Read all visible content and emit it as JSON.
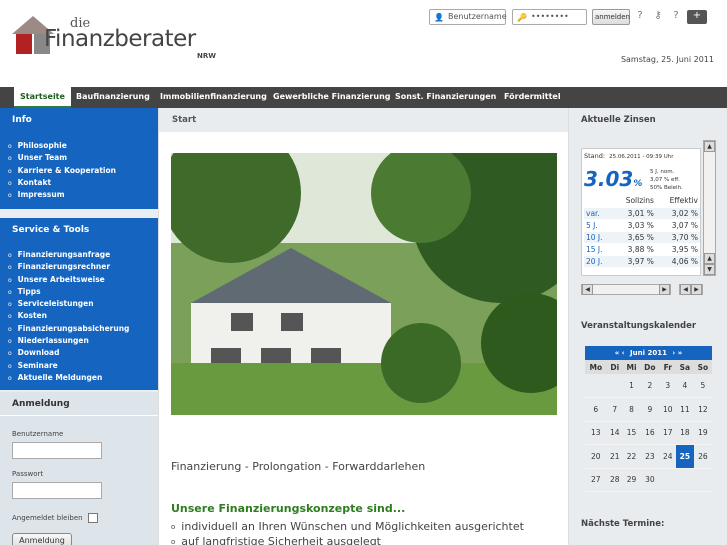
{
  "header": {
    "logo_small": "die",
    "logo_main": "Finanzberater",
    "logo_region": "NRW",
    "username_placeholder": "Benutzername",
    "password_value": "••••••••",
    "login_button": "anmelden",
    "date": "Samstag, 25. Juni 2011"
  },
  "nav": {
    "items": [
      "Startseite",
      "Baufinanzierung",
      "Immobilienfinanzierung",
      "Gewerbliche Finanzierung",
      "Sonst. Finanzierungen",
      "Fördermittel"
    ]
  },
  "sidebar": {
    "info_title": "Info",
    "info_items": [
      "Philosophie",
      "Unser Team",
      "Karriere & Kooperation",
      "Kontakt",
      "Impressum"
    ],
    "service_title": "Service & Tools",
    "service_items": [
      "Finanzierungsanfrage",
      "Finanzierungsrechner",
      "Unsere Arbeitsweise",
      "Tipps",
      "Serviceleistungen",
      "Kosten",
      "Finanzierungsabsicherung",
      "Niederlassungen",
      "Download",
      "Seminare",
      "Aktuelle Meldungen"
    ],
    "login_title": "Anmeldung",
    "username_label": "Benutzername",
    "password_label": "Passwort",
    "remember_label": "Angemeldet bleiben",
    "submit_label": "Anmeldung"
  },
  "main": {
    "breadcrumb": "Start",
    "headline": "Finanzierung - Prolongation - Forwarddarlehen",
    "subheadline": "Unsere Finanzierungskonzepte sind...",
    "bullets": [
      "individuell an Ihren Wünschen und Möglichkeiten ausgerichtet",
      "auf langfristige Sicherheit ausgelegt"
    ]
  },
  "right": {
    "rates_title": "Aktuelle Zinsen",
    "stand_label": "Stand:",
    "stand_value": "25.06.2011 - 09:39 Uhr",
    "big_rate": "3.03",
    "big_rate_unit": "%",
    "small_lines": [
      "5 J. nom.",
      "3,07 % eff.",
      "50% Beleih."
    ],
    "col_sollzins": "Sollzins",
    "col_effektiv": "Effektiv",
    "rates": [
      {
        "term": "var.",
        "soll": "3,01 %",
        "eff": "3,02 %"
      },
      {
        "term": "5 J.",
        "soll": "3,03 %",
        "eff": "3,07 %"
      },
      {
        "term": "10 J.",
        "soll": "3,65 %",
        "eff": "3,70 %"
      },
      {
        "term": "15 J.",
        "soll": "3,88 %",
        "eff": "3,95 %"
      },
      {
        "term": "20 J.",
        "soll": "3,97 %",
        "eff": "4,06 %"
      }
    ],
    "calendar_title": "Veranstaltungskalender",
    "calendar_month": "Juni 2011",
    "calendar_prev": "«",
    "calendar_prev2": "‹",
    "calendar_next": "›",
    "calendar_next2": "»",
    "weekdays": [
      "Mo",
      "Di",
      "Mi",
      "Do",
      "Fr",
      "Sa",
      "So"
    ],
    "weeks": [
      [
        "",
        "",
        "1",
        "2",
        "3",
        "4",
        "5"
      ],
      [
        "6",
        "7",
        "8",
        "9",
        "10",
        "11",
        "12"
      ],
      [
        "13",
        "14",
        "15",
        "16",
        "17",
        "18",
        "19"
      ],
      [
        "20",
        "21",
        "22",
        "23",
        "24",
        "25",
        "26"
      ],
      [
        "27",
        "28",
        "29",
        "30",
        "",
        "",
        ""
      ]
    ],
    "today": "25",
    "next_title": "Nächste Termine:"
  },
  "colors": {
    "brand_blue": "#1565c0",
    "nav_dark": "#444444",
    "accent_green": "#2e7d1f",
    "logo_red": "#b22222"
  }
}
